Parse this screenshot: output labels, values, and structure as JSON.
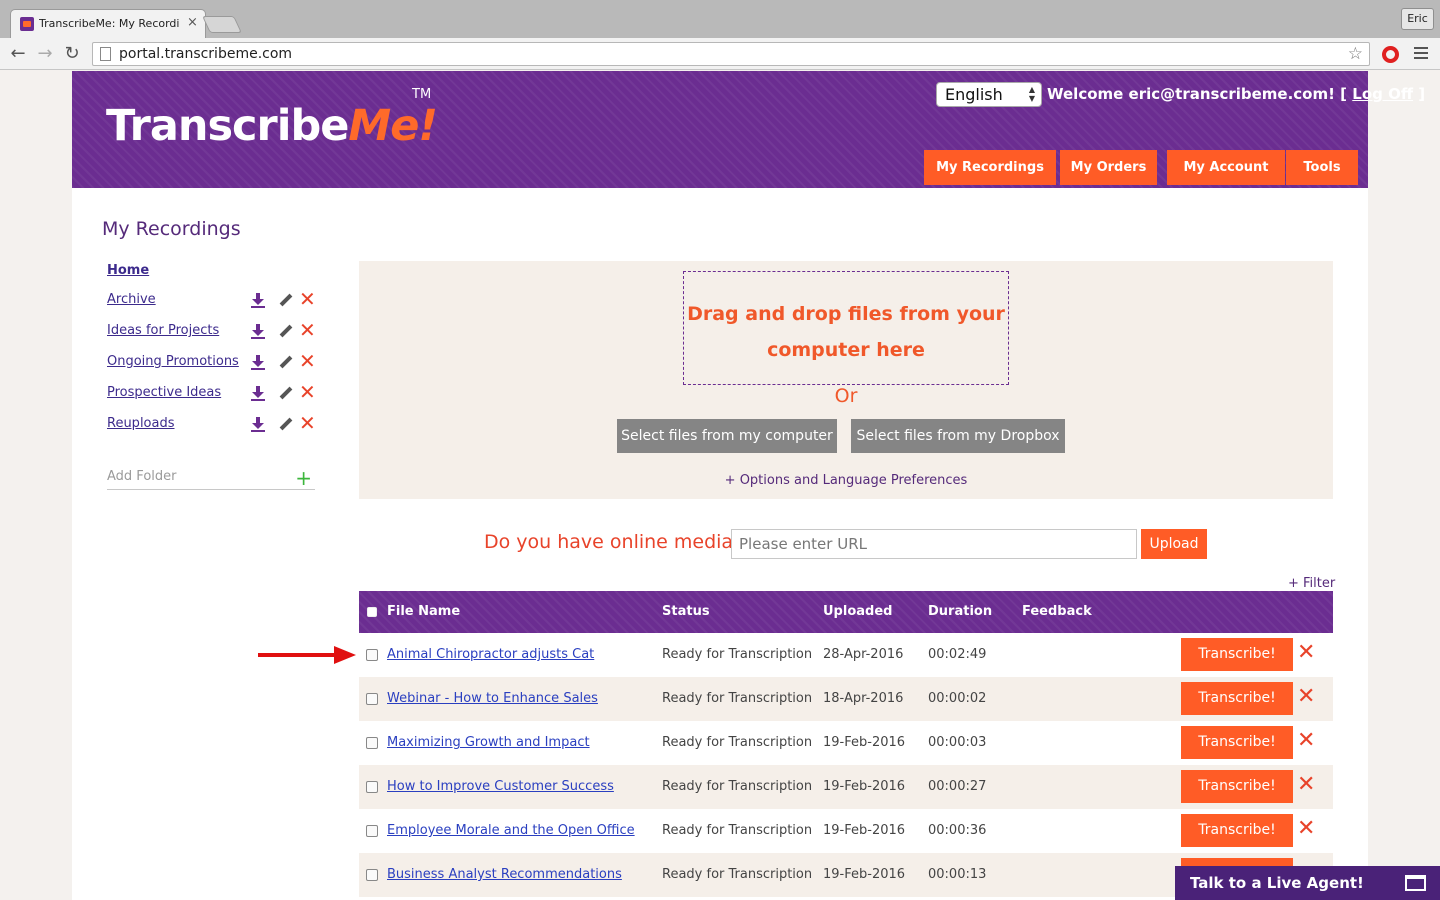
{
  "browser": {
    "tab_title": "TranscribeMe: My Recordin",
    "tab_close": "×",
    "url": "portal.transcribeme.com",
    "user_label": "Eric",
    "back_glyph": "←",
    "forward_glyph": "→",
    "reload_glyph": "↻",
    "star_glyph": "☆"
  },
  "header": {
    "logo_part1": "Transcribe",
    "logo_part2": "Me!",
    "logo_tm": "TM",
    "language": "English",
    "welcome_text": "Welcome eric@transcribeme.com! [ ",
    "logoff_label": "Log Off",
    "welcome_close": " ]",
    "nav": [
      {
        "label": "My Recordings"
      },
      {
        "label": "My Orders"
      },
      {
        "label": "My Account"
      },
      {
        "label": "Tools"
      }
    ]
  },
  "page_title": "My Recordings",
  "sidebar": {
    "home_label": "Home",
    "folders": [
      {
        "label": "Archive"
      },
      {
        "label": "Ideas for Projects"
      },
      {
        "label": "Ongoing Promotions"
      },
      {
        "label": "Prospective Ideas"
      },
      {
        "label": "Reuploads"
      }
    ],
    "add_folder_placeholder": "Add Folder",
    "add_glyph": "+",
    "delete_glyph": "✕"
  },
  "upload": {
    "drop_line1": "Drag and drop files from your",
    "drop_line2": "computer here",
    "or_text": "Or",
    "select_computer_label": "Select files from my computer",
    "select_dropbox_label": "Select files from my Dropbox",
    "options_label": "+ Options and Language Preferences"
  },
  "online_media": {
    "question": "Do you have online media?",
    "url_placeholder": "Please enter URL",
    "upload_label": "Upload"
  },
  "table": {
    "filter_label": "+ Filter",
    "columns": {
      "file_name": "File Name",
      "status": "Status",
      "uploaded": "Uploaded",
      "duration": "Duration",
      "feedback": "Feedback"
    },
    "transcribe_label": "Transcribe!",
    "delete_glyph": "✕",
    "rows": [
      {
        "name": "Animal Chiropractor adjusts Cat",
        "status": "Ready for Transcription",
        "uploaded": "28-Apr-2016",
        "duration": "00:02:49"
      },
      {
        "name": "Webinar - How to Enhance Sales",
        "status": "Ready for Transcription",
        "uploaded": "18-Apr-2016",
        "duration": "00:00:02"
      },
      {
        "name": "Maximizing Growth and Impact",
        "status": "Ready for Transcription",
        "uploaded": "19-Feb-2016",
        "duration": "00:00:03"
      },
      {
        "name": "How to Improve Customer Success",
        "status": "Ready for Transcription",
        "uploaded": "19-Feb-2016",
        "duration": "00:00:27"
      },
      {
        "name": "Employee Morale and the Open Office",
        "status": "Ready for Transcription",
        "uploaded": "19-Feb-2016",
        "duration": "00:00:36"
      },
      {
        "name": "Business Analyst Recommendations",
        "status": "Ready for Transcription",
        "uploaded": "19-Feb-2016",
        "duration": "00:00:13"
      }
    ]
  },
  "chat": {
    "label": "Talk to a Live Agent!"
  },
  "colors": {
    "brand_purple": "#6b2d91",
    "brand_orange": "#ff5c26",
    "delete_red": "#e8432a"
  }
}
